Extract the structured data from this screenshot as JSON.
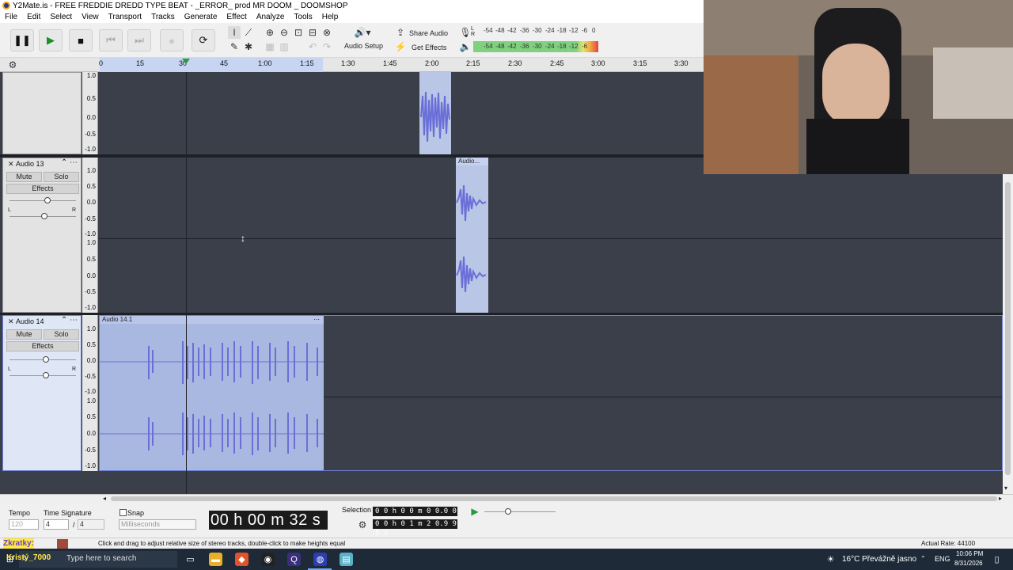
{
  "window": {
    "title": "Y2Mate.is - FREE FREDDIE DREDD TYPE BEAT - _ERROR_ prod MR DOOM _ DOOMSHOP"
  },
  "menu": [
    "File",
    "Edit",
    "Select",
    "View",
    "Transport",
    "Tracks",
    "Generate",
    "Effect",
    "Analyze",
    "Tools",
    "Help"
  ],
  "toolbar": {
    "audio_setup": "Audio Setup",
    "share_audio": "Share Audio",
    "get_effects": "Get Effects",
    "meter_ticks_top": [
      "-54",
      "-48",
      "-42",
      "-36",
      "-30",
      "-24",
      "-18",
      "-12",
      "-6",
      "0"
    ],
    "meter_ticks_bottom": [
      "-54",
      "-48",
      "-42",
      "-36",
      "-30",
      "-24",
      "-18",
      "-12",
      "-6"
    ],
    "meter_lr": [
      "L",
      "R"
    ]
  },
  "timeline": {
    "ticks": [
      "0",
      "15",
      "30",
      "45",
      "1:00",
      "1:15",
      "1:30",
      "1:45",
      "2:00",
      "2:15",
      "2:30",
      "2:45",
      "3:00",
      "3:15",
      "3:30"
    ]
  },
  "vscale_labels": [
    "1.0",
    "0.5",
    "0.0",
    "-0.5",
    "-1.0"
  ],
  "tracks": [
    {
      "name": "",
      "clip_label": ""
    },
    {
      "name": "Audio 13",
      "mute": "Mute",
      "solo": "Solo",
      "effects": "Effects",
      "clip_label": "Audio...",
      "pan_l": "L",
      "pan_r": "R"
    },
    {
      "name": "Audio 14",
      "mute": "Mute",
      "solo": "Solo",
      "effects": "Effects",
      "clip_label": "Audio 14.1",
      "pan_l": "L",
      "pan_r": "R"
    }
  ],
  "bottom": {
    "tempo_label": "Tempo",
    "tempo_value": "120",
    "timesig_label": "Time Signature",
    "timesig_num": "4",
    "timesig_sep": "/",
    "timesig_den": "4",
    "snap_label": "Snap",
    "snap_unit": "Milliseconds",
    "big_time": "00 h 00 m 32 s",
    "selection_label": "Selection",
    "sel_start": "0 0 h 0 0 m 0 0.0 0 0 s",
    "sel_end": "0 0 h 0 1 m 2 0.9 9 5 s"
  },
  "status": {
    "overlay": "Zkratky:",
    "message": "Click and drag to adjust relative size of stereo tracks, double-click to make heights equal",
    "rate": "Actual Rate: 44100"
  },
  "taskbar": {
    "search_text": "Type here to search",
    "overlay_name": "Kristý_7000",
    "weather": "16°C  Převážně jasno",
    "lang": "ENG",
    "time": "10:06 PM",
    "date": "8/31/2026"
  },
  "colors": {
    "accent": "#6b7fd6",
    "lane": "#3b3f4a",
    "clip": "#b9c6e6",
    "wave": "#6a6fd8"
  }
}
